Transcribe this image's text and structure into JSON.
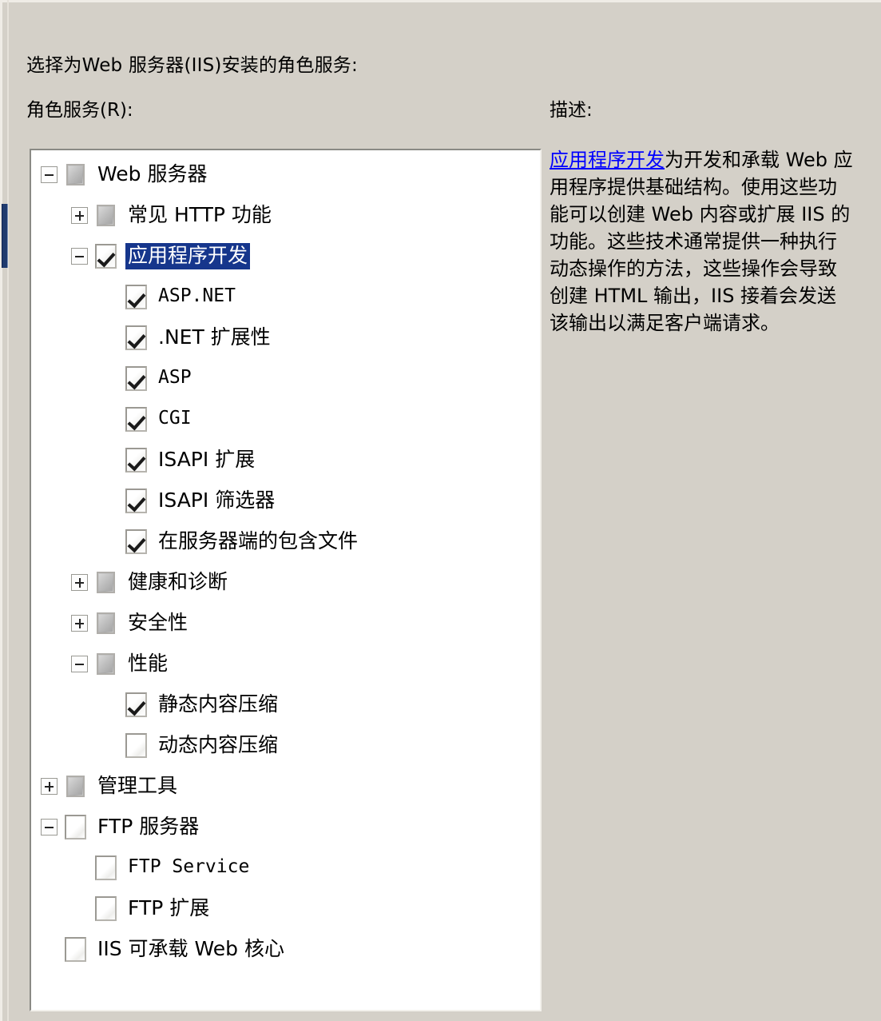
{
  "header": {
    "headline": "选择为Web 服务器(IIS)安装的角色服务:",
    "subhead": "角色服务(R):"
  },
  "description": {
    "title": "描述:",
    "link_text": "应用程序开发",
    "body_text": "为开发和承载 Web 应用程序提供基础结构。使用这些功能可以创建 Web 内容或扩展 IIS 的功能。这些技术通常提供一种执行动态操作的方法，这些操作会导致创建 HTML 输出，IIS 接着会发送该输出以满足客户端请求。"
  },
  "colors": {
    "background": "#d4d0c8",
    "selection": "#16368c",
    "link": "#0000ff",
    "focus_accent": "#1f3a6e",
    "panel_background": "#ffffff"
  },
  "tree": {
    "rows": [
      {
        "label": "Web 服务器",
        "level": 0,
        "expander": "minus",
        "check": "partial",
        "selected": false,
        "script": "cjk"
      },
      {
        "label": "常见 HTTP 功能",
        "level": 1,
        "expander": "plus",
        "check": "partial",
        "selected": false,
        "script": "cjk"
      },
      {
        "label": "应用程序开发",
        "level": 1,
        "expander": "minus",
        "check": "checked",
        "selected": true,
        "script": "cjk"
      },
      {
        "label": "ASP.NET",
        "level": 2,
        "expander": "none",
        "check": "checked",
        "selected": false,
        "script": "latin"
      },
      {
        "label": ".NET 扩展性",
        "level": 2,
        "expander": "none",
        "check": "checked",
        "selected": false,
        "script": "cjk"
      },
      {
        "label": "ASP",
        "level": 2,
        "expander": "none",
        "check": "checked",
        "selected": false,
        "script": "latin"
      },
      {
        "label": "CGI",
        "level": 2,
        "expander": "none",
        "check": "checked",
        "selected": false,
        "script": "latin"
      },
      {
        "label": "ISAPI 扩展",
        "level": 2,
        "expander": "none",
        "check": "checked",
        "selected": false,
        "script": "cjk"
      },
      {
        "label": "ISAPI 筛选器",
        "level": 2,
        "expander": "none",
        "check": "checked",
        "selected": false,
        "script": "cjk"
      },
      {
        "label": "在服务器端的包含文件",
        "level": 2,
        "expander": "none",
        "check": "checked",
        "selected": false,
        "script": "cjk"
      },
      {
        "label": "健康和诊断",
        "level": 1,
        "expander": "plus",
        "check": "partial",
        "selected": false,
        "script": "cjk"
      },
      {
        "label": "安全性",
        "level": 1,
        "expander": "plus",
        "check": "partial",
        "selected": false,
        "script": "cjk"
      },
      {
        "label": "性能",
        "level": 1,
        "expander": "minus",
        "check": "partial",
        "selected": false,
        "script": "cjk"
      },
      {
        "label": "静态内容压缩",
        "level": 2,
        "expander": "none",
        "check": "checked",
        "selected": false,
        "script": "cjk"
      },
      {
        "label": "动态内容压缩",
        "level": 2,
        "expander": "none",
        "check": "unchecked",
        "selected": false,
        "script": "cjk"
      },
      {
        "label": "管理工具",
        "level": 0,
        "expander": "plus",
        "check": "partial",
        "selected": false,
        "script": "cjk"
      },
      {
        "label": "FTP 服务器",
        "level": 0,
        "expander": "minus",
        "check": "unchecked",
        "selected": false,
        "script": "cjk"
      },
      {
        "label": "FTP Service",
        "level": 1,
        "expander": "none",
        "check": "unchecked",
        "selected": false,
        "script": "latin"
      },
      {
        "label": "FTP 扩展",
        "level": 1,
        "expander": "none",
        "check": "unchecked",
        "selected": false,
        "script": "cjk"
      },
      {
        "label": "IIS 可承载 Web 核心",
        "level": 0,
        "expander": "none",
        "check": "unchecked",
        "selected": false,
        "script": "cjk"
      }
    ]
  }
}
